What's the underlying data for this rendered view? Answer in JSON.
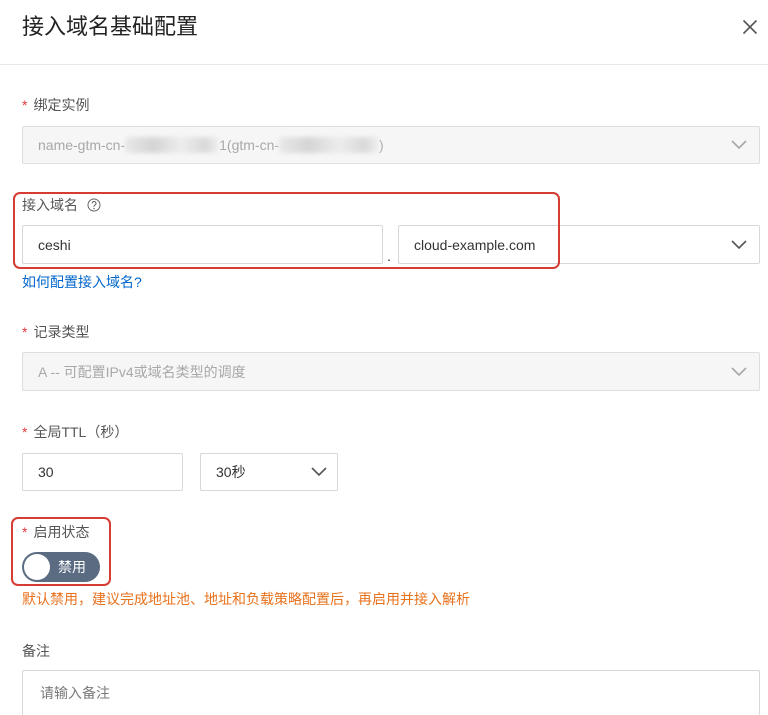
{
  "dialog": {
    "title": "接入域名基础配置",
    "close_icon": "close-icon"
  },
  "form": {
    "required_mark": "*",
    "instance": {
      "label": "绑定实例",
      "value_prefix": "name-gtm-cn-",
      "value_middle": "1(gtm-cn-",
      "value_suffix": ")",
      "disabled": true,
      "icon": "chevron-down-icon"
    },
    "domain": {
      "label": "接入域名",
      "help_icon": "help-circle-icon",
      "subdomain_value": "ceshi",
      "separator": ".",
      "root_domain_value": "cloud-example.com",
      "help_link": "如何配置接入域名?"
    },
    "record_type": {
      "label": "记录类型",
      "value": "A -- 可配置IPv4或域名类型的调度",
      "disabled": true
    },
    "ttl": {
      "label": "全局TTL（秒）",
      "value": "30",
      "unit_select": "30秒"
    },
    "status": {
      "label": "启用状态",
      "toggle_label": "禁用",
      "enabled": false,
      "hint": "默认禁用，建议完成地址池、地址和负载策略配置后，再启用并接入解析"
    },
    "remark": {
      "label": "备注",
      "placeholder": "请输入备注"
    }
  },
  "colors": {
    "required": "#e4393c",
    "link": "#0066cc",
    "highlight_border": "#d53c33",
    "toggle_off": "#5b6b82",
    "hint": "#e8711c"
  }
}
